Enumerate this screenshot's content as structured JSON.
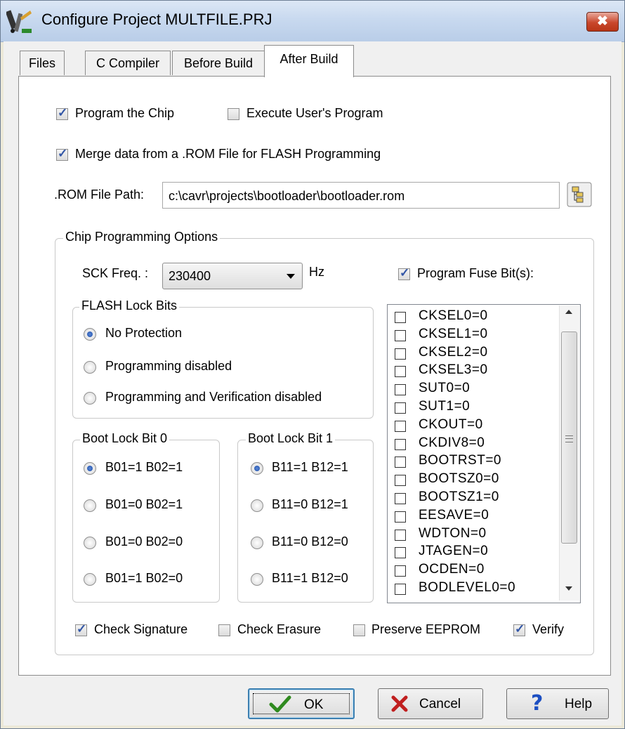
{
  "window": {
    "title": "Configure Project MULTFILE.PRJ",
    "close_glyph": "✖"
  },
  "tabs": [
    {
      "label": "Files"
    },
    {
      "label": "C Compiler"
    },
    {
      "label": "Before Build"
    },
    {
      "label": "After Build",
      "active": true
    }
  ],
  "options": {
    "program_chip": {
      "label": "Program the Chip",
      "checked": true
    },
    "execute_user": {
      "label": "Execute User's Program",
      "checked": false
    },
    "merge_rom": {
      "label": "Merge data from a .ROM File for FLASH Programming",
      "checked": true
    }
  },
  "rom_path": {
    "label": ".ROM File Path:",
    "value": "c:\\cavr\\projects\\bootloader\\bootloader.rom"
  },
  "chip_group": {
    "legend": "Chip Programming Options",
    "sck_label": "SCK Freq. :",
    "sck_value": "230400",
    "sck_unit": "Hz",
    "program_fuse": {
      "label": "Program Fuse Bit(s):",
      "checked": true
    }
  },
  "flash_lock": {
    "legend": "FLASH Lock Bits",
    "options": [
      {
        "label": "No Protection",
        "selected": true
      },
      {
        "label": "Programming disabled",
        "selected": false
      },
      {
        "label": "Programming and Verification disabled",
        "selected": false
      }
    ]
  },
  "boot_lock_0": {
    "legend": "Boot Lock Bit 0",
    "options": [
      {
        "label": "B01=1 B02=1",
        "selected": true
      },
      {
        "label": "B01=0 B02=1",
        "selected": false
      },
      {
        "label": "B01=0 B02=0",
        "selected": false
      },
      {
        "label": "B01=1 B02=0",
        "selected": false
      }
    ]
  },
  "boot_lock_1": {
    "legend": "Boot Lock Bit 1",
    "options": [
      {
        "label": "B11=1 B12=1",
        "selected": true
      },
      {
        "label": "B11=0 B12=1",
        "selected": false
      },
      {
        "label": "B11=0 B12=0",
        "selected": false
      },
      {
        "label": "B11=1 B12=0",
        "selected": false
      }
    ]
  },
  "fuse_bits": [
    "CKSEL0=0",
    "CKSEL1=0",
    "CKSEL2=0",
    "CKSEL3=0",
    "SUT0=0",
    "SUT1=0",
    "CKOUT=0",
    "CKDIV8=0",
    "BOOTRST=0",
    "BOOTSZ0=0",
    "BOOTSZ1=0",
    "EESAVE=0",
    "WDTON=0",
    "JTAGEN=0",
    "OCDEN=0",
    "BODLEVEL0=0"
  ],
  "checks": {
    "check_signature": {
      "label": "Check Signature",
      "checked": true
    },
    "check_erasure": {
      "label": "Check Erasure",
      "checked": false
    },
    "preserve_eeprom": {
      "label": "Preserve EEPROM",
      "checked": false
    },
    "verify": {
      "label": "Verify",
      "checked": true
    }
  },
  "buttons": {
    "ok": {
      "label": "OK",
      "icon": "checkmark-icon"
    },
    "cancel": {
      "label": "Cancel",
      "icon": "x-icon"
    },
    "help": {
      "label": "Help",
      "icon": "question-icon"
    }
  },
  "colors": {
    "accent": "#3256a6",
    "ok_icon": "#2f8a1f",
    "cancel_icon": "#c01f1f",
    "help_icon": "#1c4fc2"
  }
}
